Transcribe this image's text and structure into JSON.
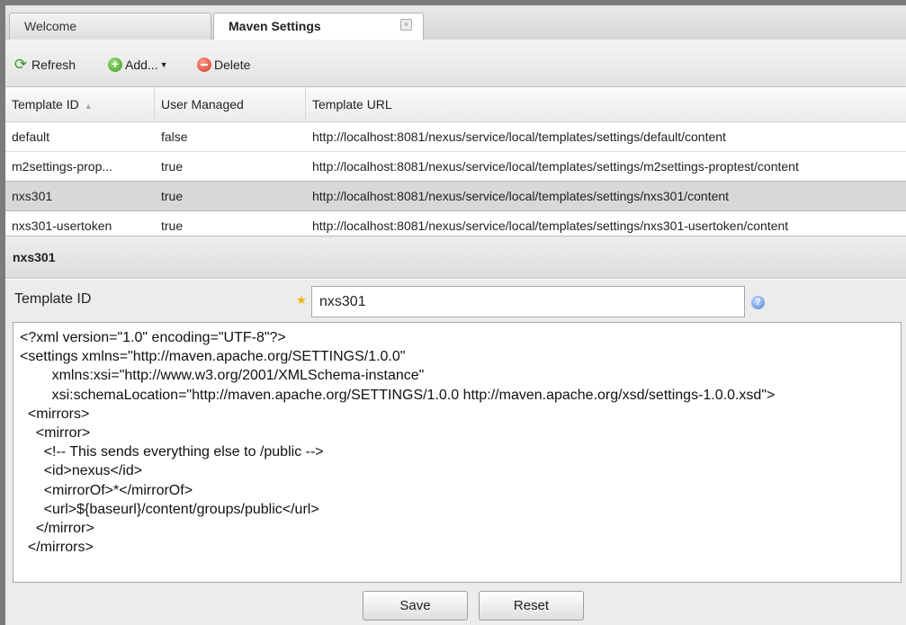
{
  "tabs": [
    {
      "label": "Welcome"
    },
    {
      "label": "Maven Settings",
      "close_label": "×"
    }
  ],
  "toolbar": {
    "refresh_label": "Refresh",
    "add_label": "Add...",
    "delete_label": "Delete"
  },
  "grid": {
    "columns": [
      {
        "label": "Template ID",
        "sort": "ascending"
      },
      {
        "label": "User Managed"
      },
      {
        "label": "Template URL"
      }
    ],
    "rows": [
      {
        "id": "default",
        "user_managed": "false",
        "url": "http://localhost:8081/nexus/service/local/templates/settings/default/content",
        "selected": false
      },
      {
        "id": "m2settings-prop...",
        "user_managed": "true",
        "url": "http://localhost:8081/nexus/service/local/templates/settings/m2settings-proptest/content",
        "selected": false
      },
      {
        "id": "nxs301",
        "user_managed": "true",
        "url": "http://localhost:8081/nexus/service/local/templates/settings/nxs301/content",
        "selected": true
      },
      {
        "id": "nxs301-usertoken",
        "user_managed": "true",
        "url": "http://localhost:8081/nexus/service/local/templates/settings/nxs301-usertoken/content",
        "selected": false
      }
    ]
  },
  "detail": {
    "title": "nxs301",
    "template_id_label": "Template ID",
    "required_mark": "★",
    "template_id_value": "nxs301",
    "help_glyph": "?",
    "content": "<?xml version=\"1.0\" encoding=\"UTF-8\"?>\n<settings xmlns=\"http://maven.apache.org/SETTINGS/1.0.0\"\n        xmlns:xsi=\"http://www.w3.org/2001/XMLSchema-instance\"\n        xsi:schemaLocation=\"http://maven.apache.org/SETTINGS/1.0.0 http://maven.apache.org/xsd/settings-1.0.0.xsd\">\n  <mirrors>\n    <mirror>\n      <!-- This sends everything else to /public -->\n      <id>nexus</id>\n      <mirrorOf>*</mirrorOf>\n      <url>${baseurl}/content/groups/public</url>\n    </mirror>\n  </mirrors>",
    "save_label": "Save",
    "reset_label": "Reset"
  },
  "icons": {
    "refresh": "refresh-icon",
    "add": "add-icon",
    "delete": "delete-icon",
    "help": "help-icon",
    "close": "close-icon",
    "sort": "sort-asc-icon"
  },
  "colors": {
    "selected_row": "#d8d8d8",
    "required_star": "#f0b400"
  }
}
